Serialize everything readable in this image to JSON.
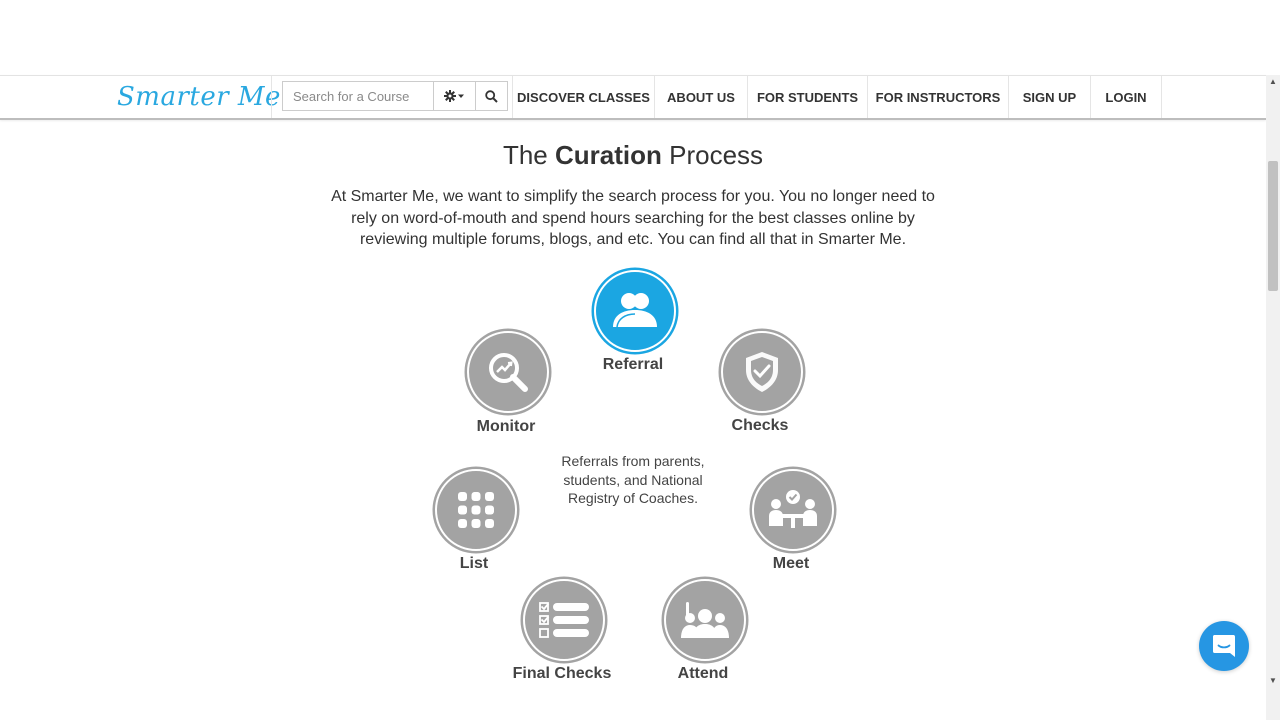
{
  "header": {
    "logo_text": "Smarter Me",
    "search": {
      "placeholder": "Search for a Course",
      "value": ""
    },
    "nav": [
      {
        "label": "DISCOVER CLASSES"
      },
      {
        "label": "ABOUT US"
      },
      {
        "label": "FOR STUDENTS"
      },
      {
        "label": "FOR INSTRUCTORS"
      },
      {
        "label": "SIGN UP"
      },
      {
        "label": "LOGIN"
      }
    ]
  },
  "main": {
    "title_pre": "The",
    "title_bold": "Curation",
    "title_post": "Process",
    "intro": "At Smarter Me, we want to simplify the search process for you. You no longer need to rely on word-of-mouth and spend hours searching for the best classes online by reviewing multiple forums, blogs, and etc. You can find all that in Smarter Me.",
    "steps": [
      {
        "label": "Referral",
        "icon": "people-icon",
        "active": true
      },
      {
        "label": "Checks",
        "icon": "shield-check-icon",
        "active": false
      },
      {
        "label": "Meet",
        "icon": "meeting-icon",
        "active": false
      },
      {
        "label": "Attend",
        "icon": "class-attend-icon",
        "active": false
      },
      {
        "label": "Final Checks",
        "icon": "checklist-icon",
        "active": false
      },
      {
        "label": "List",
        "icon": "grid-list-icon",
        "active": false
      },
      {
        "label": "Monitor",
        "icon": "magnifier-chart-icon",
        "active": false
      }
    ],
    "active_description": "Referrals from parents, students, and National Registry of Coaches."
  },
  "colors": {
    "brand": "#2aa8e0",
    "active_step": "#1ba6e2",
    "inactive_step": "#a3a3a3",
    "chat": "#2696e3"
  },
  "chat_widget": {
    "icon": "chat-icon"
  }
}
